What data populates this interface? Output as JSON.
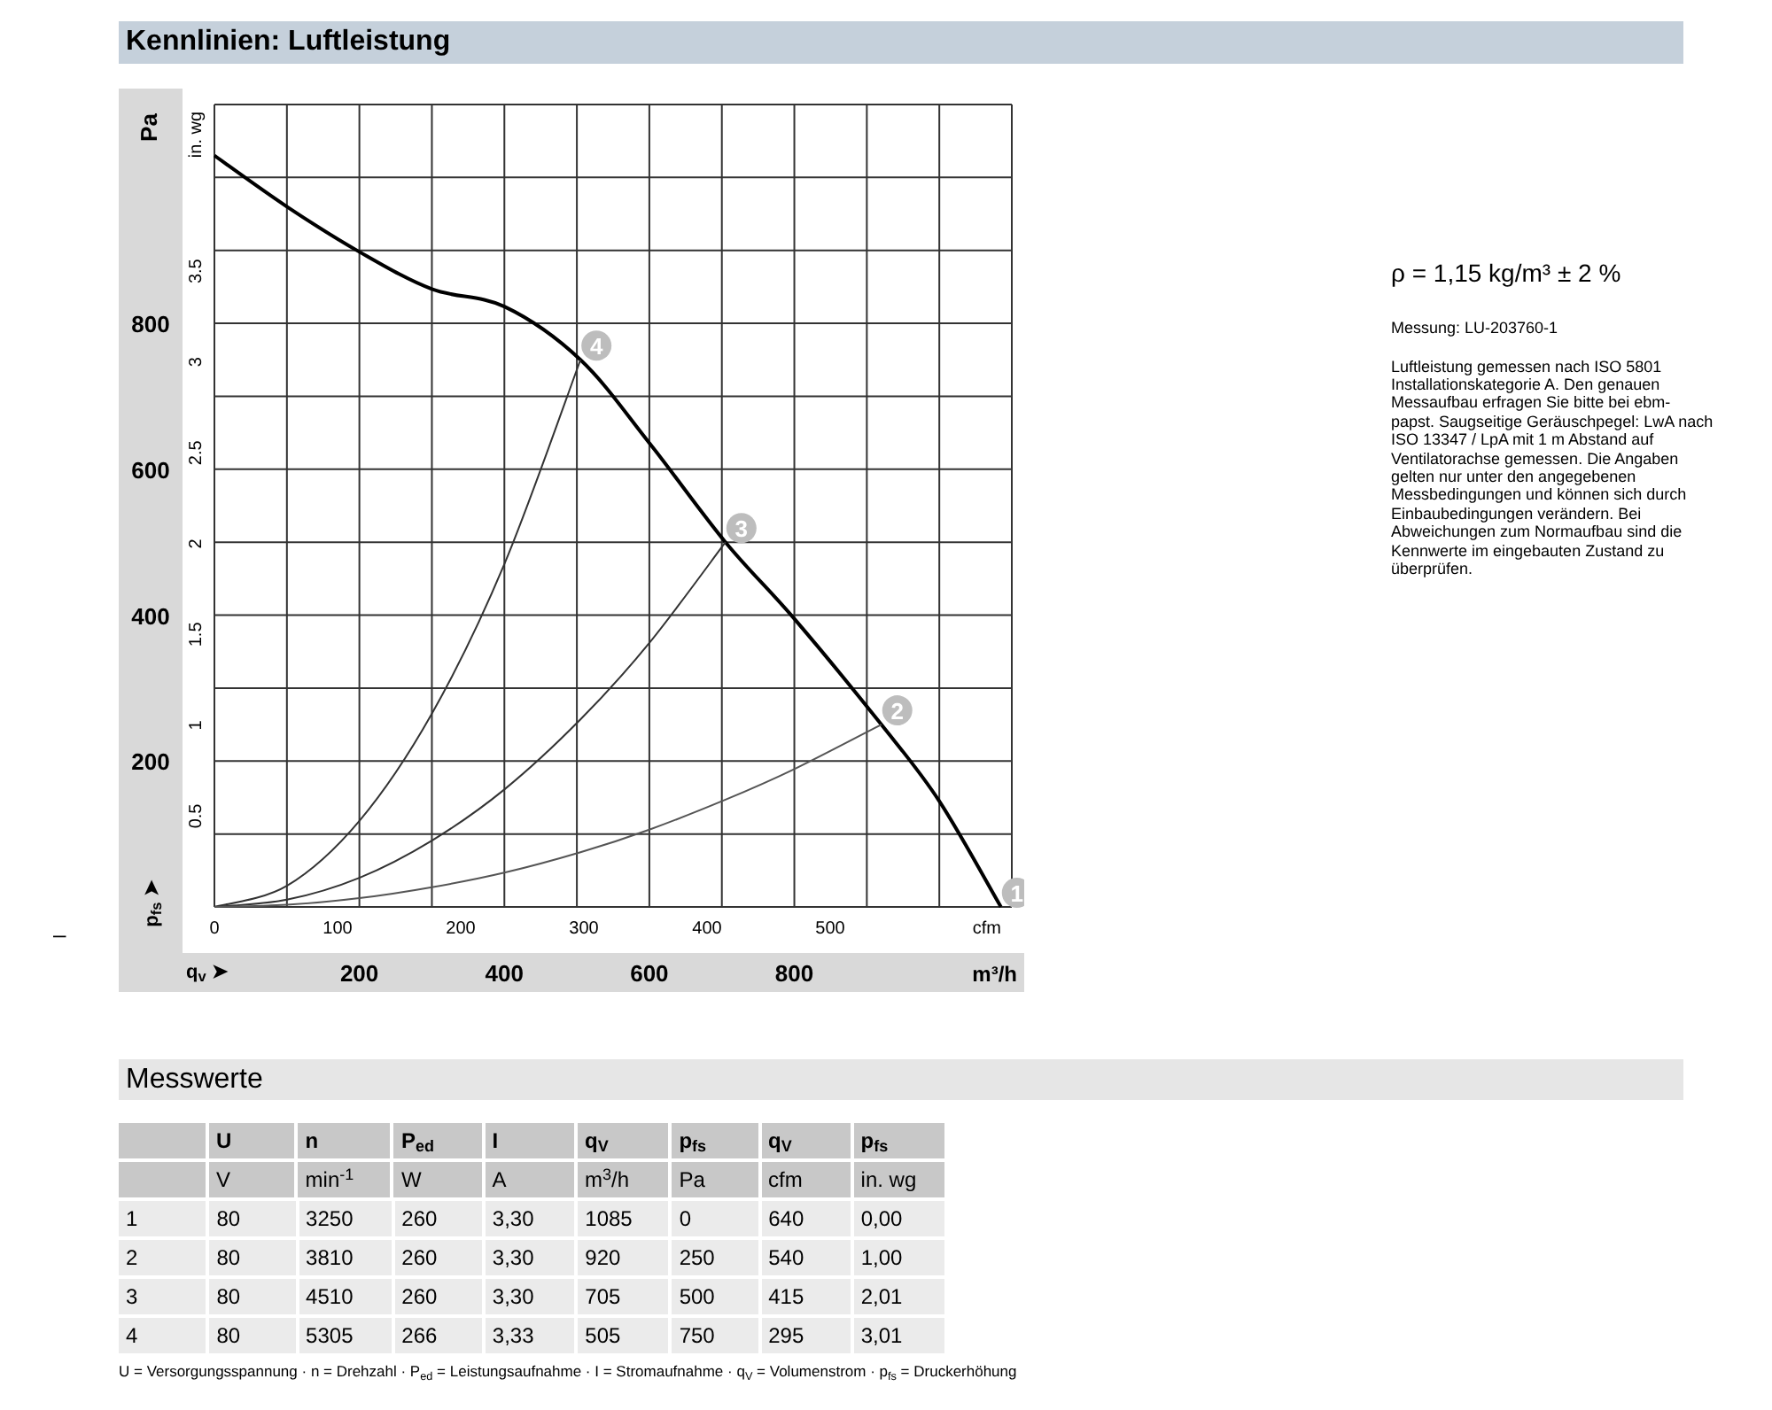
{
  "side_mark": "–",
  "chart_section": {
    "title": "Kennlinien: Luftleistung",
    "secondary_y": {
      "label": "in. wg",
      "ticks": [
        "0.5",
        "1",
        "1.5",
        "2",
        "2.5",
        "3",
        "3.5"
      ]
    },
    "secondary_x": {
      "label": "cfm",
      "ticks": [
        "0",
        "100",
        "200",
        "300",
        "400",
        "500"
      ]
    },
    "operating_points": [
      "1",
      "2",
      "3",
      "4"
    ],
    "y_axis_symbol": "p$_{fs}$ ➤",
    "x_axis_symbol": "q$_{v}$ ➤",
    "chart_data": {
      "type": "line",
      "xlabel": "m³/h",
      "ylabel": "Pa",
      "x": [
        0,
        100,
        200,
        300,
        400,
        505,
        600,
        705,
        800,
        920,
        1000,
        1085
      ],
      "series": [
        {
          "color": "#000000",
          "values": [
            1030,
            960,
            898,
            847,
            823,
            750,
            636,
            500,
            395,
            250,
            145,
            0
          ]
        },
        {
          "color": "#333333",
          "values": [
            0,
            29,
            118,
            265,
            470,
            750,
            null,
            null,
            null,
            null,
            null,
            null
          ]
        },
        {
          "color": "#333333",
          "values": [
            0,
            10,
            40,
            91,
            161,
            257,
            362,
            500,
            null,
            null,
            null,
            null
          ]
        },
        {
          "color": "#555555",
          "values": [
            0,
            3,
            12,
            27,
            47,
            75,
            106,
            147,
            189,
            250,
            null,
            null
          ]
        }
      ],
      "xlim": [
        0,
        1100
      ],
      "ylim": [
        0,
        1100
      ],
      "xticks": [
        200,
        400,
        600,
        800
      ],
      "yticks": [
        200,
        400,
        600,
        800
      ],
      "grid": true
    }
  },
  "notes": {
    "density": "ρ = 1,15 kg/m³ ± 2 %",
    "measurement": "Messung: LU-203760-1",
    "description": "Luftleistung gemessen nach ISO 5801 Installationskategorie A. Den genauen Messaufbau erfragen Sie bitte bei ebm-papst. Saugseitige Geräuschpegel: LwA nach ISO 13347 / LpA mit 1 m Abstand auf Ventilatorachse gemessen. Die Angaben gelten nur unter den angegebenen Messbedingungen und können sich durch Einbaubedingungen verändern. Bei Abweichungen zum Normaufbau sind die Kennwerte im eingebauten Zustand zu überprüfen."
  },
  "measurements": {
    "title": "Messwerte",
    "header": [
      "U",
      "n",
      "P$_{ed}$",
      "I",
      "q$_{V}$",
      "p$_{fs}$",
      "q$_{V}$",
      "p$_{fs}$"
    ],
    "units": [
      "V",
      "min$^{-1}$",
      "W",
      "A",
      "m$^{3}$/h",
      "Pa",
      "cfm",
      "in. wg"
    ],
    "rows": [
      [
        "1",
        "80",
        "3250",
        "260",
        "3,30",
        "1085",
        "0",
        "640",
        "0,00"
      ],
      [
        "2",
        "80",
        "3810",
        "260",
        "3,30",
        "920",
        "250",
        "540",
        "1,00"
      ],
      [
        "3",
        "80",
        "4510",
        "260",
        "3,30",
        "705",
        "500",
        "415",
        "2,01"
      ],
      [
        "4",
        "80",
        "5305",
        "266",
        "3,33",
        "505",
        "750",
        "295",
        "3,01"
      ]
    ],
    "legend": "U = Versorgungsspannung · n = Drehzahl · P$_{ed}$ = Leistungsaufnahme · I = Stromaufnahme · q$_{V}$ = Volumenstrom · p$_{fs}$ = Druckerhöhung"
  }
}
